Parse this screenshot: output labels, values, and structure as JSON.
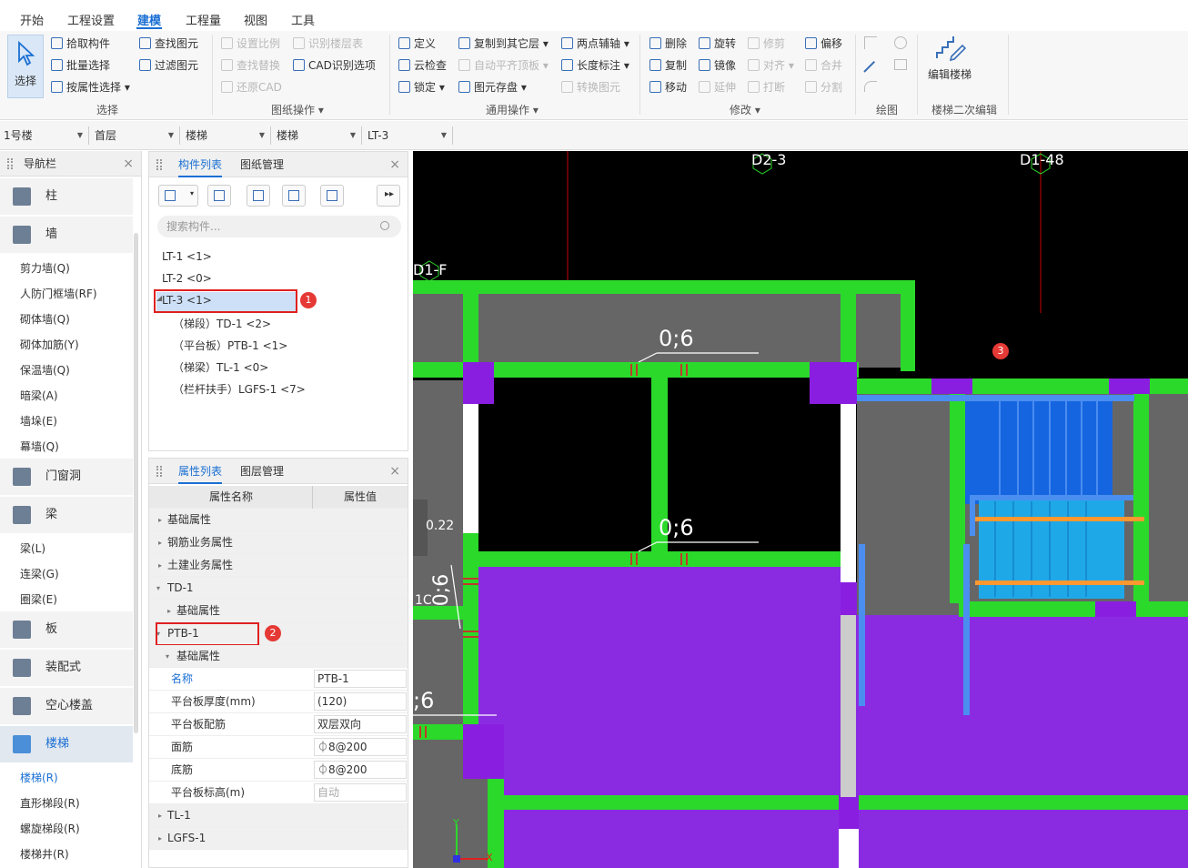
{
  "menu": {
    "tabs": [
      {
        "label": "开始"
      },
      {
        "label": "工程设置"
      },
      {
        "label": "建模"
      },
      {
        "label": "工程量"
      },
      {
        "label": "视图"
      },
      {
        "label": "工具"
      }
    ]
  },
  "ribbon": {
    "select": {
      "label": "选择"
    },
    "select_group": {
      "pick": "拾取构件",
      "batch": "批量选择",
      "by_prop": "按属性选择",
      "find": "查找图元",
      "filter": "过滤图元",
      "label": "选择"
    },
    "drawing_group": {
      "set_scale": "设置比例",
      "identify_floor": "识别楼层表",
      "find_replace": "查找替换",
      "cad_options": "CAD识别选项",
      "restore_cad": "还原CAD",
      "label": "图纸操作"
    },
    "common_group": {
      "define": "定义",
      "copy_floor": "复制到其它层",
      "two_point_axis": "两点辅轴",
      "cloud_check": "云检查",
      "auto_align": "自动平齐顶板",
      "length_dim": "长度标注",
      "lock": "锁定",
      "save_element": "图元存盘",
      "convert_element": "转换图元",
      "label": "通用操作"
    },
    "modify_group": {
      "delete": "删除",
      "rotate": "旋转",
      "trim": "修剪",
      "offset": "偏移",
      "copy": "复制",
      "mirror": "镜像",
      "align": "对齐",
      "merge": "合并",
      "move": "移动",
      "extend": "延伸",
      "break": "打断",
      "split": "分割",
      "label": "修改"
    },
    "draw_group": {
      "label": "绘图"
    },
    "stair_edit": {
      "button": "编辑楼梯",
      "label": "楼梯二次编辑"
    }
  },
  "filters": {
    "building": "1号楼",
    "floor": "首层",
    "category": "楼梯",
    "type": "楼梯",
    "component": "LT-3"
  },
  "nav": {
    "title": "导航栏",
    "items": [
      {
        "label": "柱"
      },
      {
        "label": "墙"
      },
      {
        "label": "剪力墙(Q)"
      },
      {
        "label": "人防门框墙(RF)"
      },
      {
        "label": "砌体墙(Q)"
      },
      {
        "label": "砌体加筋(Y)"
      },
      {
        "label": "保温墙(Q)"
      },
      {
        "label": "暗梁(A)"
      },
      {
        "label": "墙垛(E)"
      },
      {
        "label": "幕墙(Q)"
      },
      {
        "label": "门窗洞"
      },
      {
        "label": "梁"
      },
      {
        "label": "梁(L)"
      },
      {
        "label": "连梁(G)"
      },
      {
        "label": "圈梁(E)"
      },
      {
        "label": "板"
      },
      {
        "label": "装配式"
      },
      {
        "label": "空心楼盖"
      },
      {
        "label": "楼梯"
      },
      {
        "label": "楼梯(R)"
      },
      {
        "label": "直形梯段(R)"
      },
      {
        "label": "螺旋梯段(R)"
      },
      {
        "label": "楼梯井(R)"
      }
    ]
  },
  "components": {
    "tab_list": "构件列表",
    "tab_drawings": "图纸管理",
    "search_placeholder": "搜索构件...",
    "items": [
      {
        "label": "LT-1 <1>"
      },
      {
        "label": "LT-2 <0>"
      },
      {
        "label": "LT-3 <1>"
      },
      {
        "label": "（梯段）TD-1 <2>"
      },
      {
        "label": "（平台板）PTB-1 <1>"
      },
      {
        "label": "（梯梁）TL-1 <0>"
      },
      {
        "label": "（栏杆扶手）LGFS-1 <7>"
      }
    ]
  },
  "properties": {
    "tab_props": "属性列表",
    "tab_layers": "图层管理",
    "col_name": "属性名称",
    "col_value": "属性值",
    "rows": [
      {
        "key": "基础属性"
      },
      {
        "key": "钢筋业务属性"
      },
      {
        "key": "土建业务属性"
      },
      {
        "key": "TD-1"
      },
      {
        "key": "基础属性"
      },
      {
        "key": "PTB-1"
      },
      {
        "key": "基础属性"
      },
      {
        "key": "名称",
        "value": "PTB-1"
      },
      {
        "key": "平台板厚度(mm)",
        "value": "(120)"
      },
      {
        "key": "平台板配筋",
        "value": "双层双向"
      },
      {
        "key": "面筋",
        "value": "⏀8@200"
      },
      {
        "key": "底筋",
        "value": "⏀8@200"
      },
      {
        "key": "平台板标高(m)",
        "value": "自动"
      },
      {
        "key": "TL-1"
      },
      {
        "key": "LGFS-1"
      }
    ]
  },
  "badges": [
    "1",
    "2",
    "3"
  ],
  "canvas": {
    "labels": {
      "d2_3": "D2-3",
      "d1_48": "D1-48",
      "d1_f": "D1-F",
      "dim1": "0;6",
      "dim2": "0;6",
      "dim3": "0;6",
      "dim_left": ";6",
      "vert": "0;6",
      "elev": "0.22",
      "c1": "1C"
    },
    "axis": {
      "x": "X",
      "y": "Y"
    }
  }
}
